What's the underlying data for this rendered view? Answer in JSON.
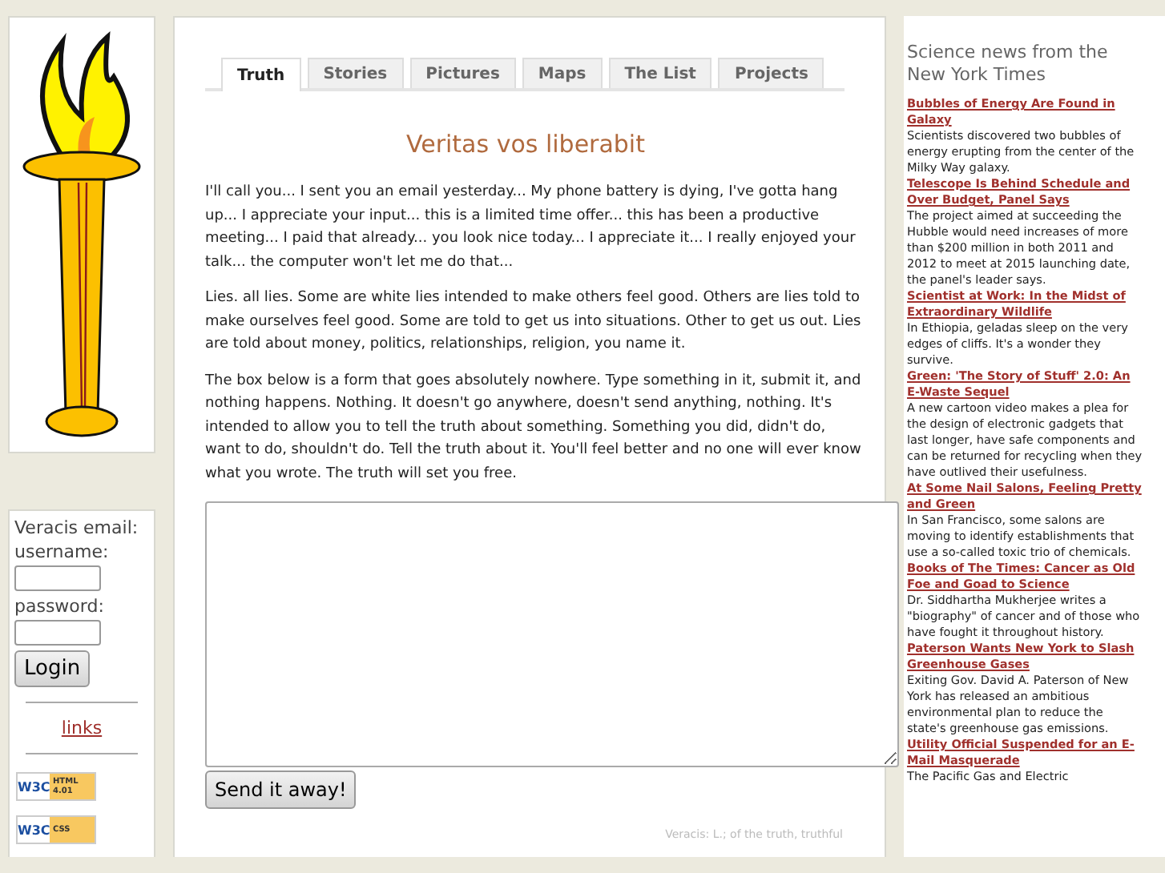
{
  "login": {
    "title": "Veracis email:",
    "fields": [
      {
        "label": "username:"
      },
      {
        "label": "password:"
      }
    ],
    "button": "Login"
  },
  "links": "links",
  "badges": [
    {
      "left": "W3C",
      "right": "HTML 4.01"
    },
    {
      "left": "W3C",
      "right": "CSS"
    }
  ],
  "tabs": [
    {
      "label": "Truth",
      "selected": true
    },
    {
      "label": "Stories",
      "selected": false
    },
    {
      "label": "Pictures",
      "selected": false
    },
    {
      "label": "Maps",
      "selected": false
    },
    {
      "label": "The List",
      "selected": false
    },
    {
      "label": "Projects",
      "selected": false
    }
  ],
  "heading": "Veritas vos liberabit",
  "paragraphs": [
    "I'll call you... I sent you an email yesterday... My phone battery is dying, I've gotta hang up... I appreciate your input... this is a limited time offer... this has been a productive meeting... I paid that already... you look nice today... I appreciate it... I really enjoyed your talk... the computer won't let me do that...",
    "Lies. all lies. Some are white lies intended to make others feel good. Others are lies told to make ourselves feel good. Some are told to get us into situations. Other to get us out. Lies are told about money, politics, relationships, religion, you name it.",
    "The box below is a form that goes absolutely nowhere. Type something in it, submit it, and nothing happens. Nothing. It doesn't go anywhere, doesn't send anything, nothing. It's intended to allow you to tell the truth about something. Something you did, didn't do, want to do, shouldn't do. Tell the truth about it. You'll feel better and no one will ever know what you wrote. The truth will set you free."
  ],
  "submit": "Send it away!",
  "footer": "Veracis: L.; of the truth, truthful",
  "news": {
    "title": "Science news from the New York Times",
    "items": [
      {
        "link": "Bubbles of Energy Are Found in Galaxy",
        "summary": "Scientists discovered two bubbles of energy erupting from the center of the Milky Way galaxy."
      },
      {
        "link": "Telescope Is Behind Schedule and Over Budget, Panel Says",
        "summary": "The project aimed at succeeding the Hubble would need increases of more than $200 million in both 2011 and 2012 to meet at 2015 launching date, the panel's leader says."
      },
      {
        "link": "Scientist at Work: In the Midst of Extraordinary Wildlife",
        "summary": "In Ethiopia, geladas sleep on the very edges of cliffs. It's a wonder they survive."
      },
      {
        "link": "Green: 'The Story of Stuff' 2.0: An E-Waste Sequel",
        "summary": "A new cartoon video makes a plea for the design of electronic gadgets that last longer, have safe components and can be returned for recycling when they have outlived their usefulness."
      },
      {
        "link": "At Some Nail Salons, Feeling Pretty and Green",
        "summary": "In San Francisco, some salons are moving to identify establishments that use a so-called toxic trio of chemicals."
      },
      {
        "link": "Books of The Times: Cancer as Old Foe and Goad to Science",
        "summary": "Dr. Siddhartha Mukherjee writes a \"biography\" of cancer and of those who have fought it throughout history."
      },
      {
        "link": "Paterson Wants New York to Slash Greenhouse Gases",
        "summary": "Exiting Gov. David A. Paterson of New York has released an ambitious environmental plan to reduce the state's greenhouse gas emissions."
      },
      {
        "link": "Utility Official Suspended for an E-Mail Masquerade",
        "summary": "The Pacific Gas and Electric"
      }
    ]
  }
}
